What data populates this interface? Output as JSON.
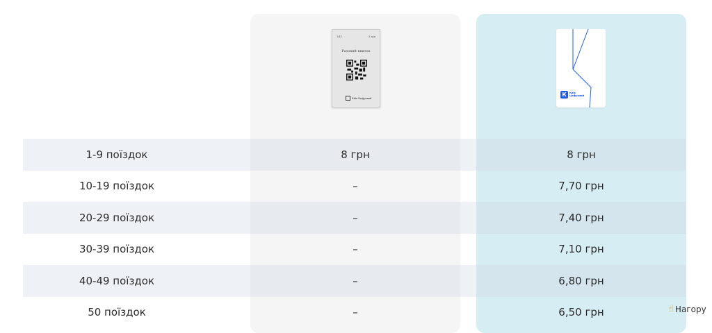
{
  "ticket": {
    "top_left": "1/45",
    "top_right": "8 грн",
    "title": "Разовий квиток",
    "logo_text": "Київ Цифровий"
  },
  "card": {
    "badge": "К",
    "brand_line1": "Київ",
    "brand_line2": "Цифровий"
  },
  "rows": [
    {
      "trips": "1-9 поїздок",
      "paper": "8 грн",
      "card": "8 грн"
    },
    {
      "trips": "10-19 поїздок",
      "paper": "–",
      "card": "7,70 грн"
    },
    {
      "trips": "20-29 поїздок",
      "paper": "–",
      "card": "7,40 грн"
    },
    {
      "trips": "30-39 поїздок",
      "paper": "–",
      "card": "7,10 грн"
    },
    {
      "trips": "40-49 поїздок",
      "paper": "–",
      "card": "6,80 грн"
    },
    {
      "trips": "50 поїздок",
      "paper": "–",
      "card": "6,50 грн"
    }
  ],
  "footer": {
    "hagopy_label": "Нагору",
    "hand_icon": "pointing-hand-icon"
  },
  "colors": {
    "paper_column": "#f5f5f5",
    "card_column": "#d7edf4",
    "brand_blue": "#1e5ae8"
  }
}
